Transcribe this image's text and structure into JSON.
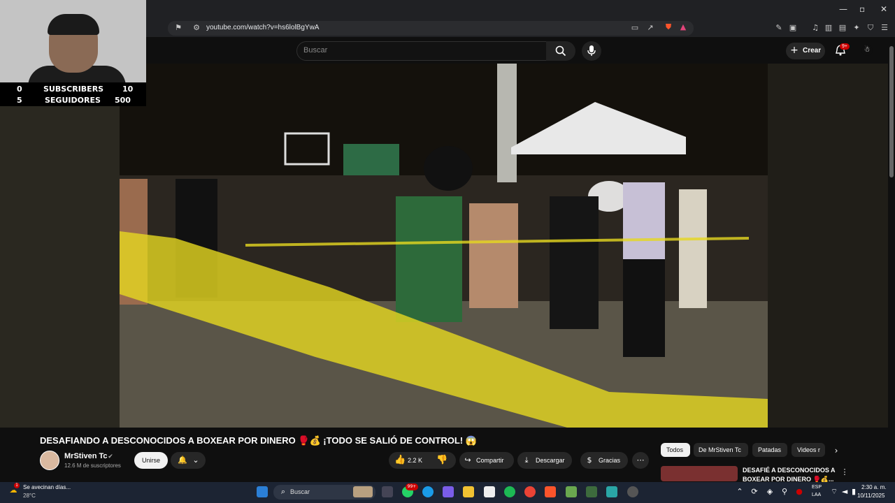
{
  "browser": {
    "url": "youtube.com/watch?v=hs6lolBgYwA"
  },
  "overlay": {
    "subs_left": "0",
    "subs_label": "SUBSCRIBERS",
    "subs_right": "10",
    "seg_left": "5",
    "seg_label": "SEGUIDORES",
    "seg_right": "500"
  },
  "header": {
    "search_placeholder": "Buscar",
    "create_label": "Crear",
    "notif_count": "9+"
  },
  "video": {
    "title": "DESAFIANDO A DESCONOCIDOS A BOXEAR POR DINERO 🥊💰 ¡TODO SE SALIÓ DE CONTROL! 😱",
    "channel": "MrStiven Tc",
    "subscribers": "12.6 M de suscriptores",
    "join_label": "Unirse",
    "likes": "2.2 K",
    "share_label": "Compartir",
    "download_label": "Descargar",
    "thanks_label": "Gracias"
  },
  "chips": [
    "Todos",
    "De MrStiven Tc",
    "Patadas",
    "Videos r"
  ],
  "related": {
    "title": "DESAFIÉ A DESCONOCIDOS A",
    "title2": "BOXEAR POR DINERO 🥊💰..."
  },
  "taskbar": {
    "weather_line1": "Se avecinan días...",
    "weather_line2": "28°C",
    "search_label": "Buscar",
    "lang1": "ESP",
    "lang2": "LAA",
    "time": "2:30 a. m.",
    "date": "10/11/2025",
    "badge": "99+"
  },
  "colors": {
    "accent": "#cc0000",
    "tape": "#e6d820",
    "taskbar": "#1c2433"
  }
}
